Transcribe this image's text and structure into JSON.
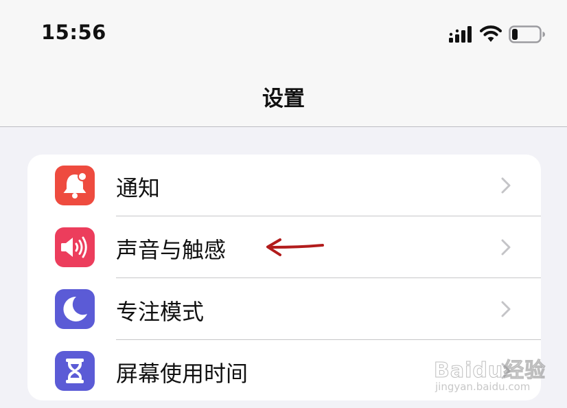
{
  "status_bar": {
    "time": "15:56",
    "icons": [
      "cellular-signal-icon",
      "wifi-icon",
      "battery-icon"
    ],
    "battery_level": 0.2
  },
  "nav": {
    "title": "设置"
  },
  "settings": {
    "items": [
      {
        "label": "通知",
        "icon": "bell-icon",
        "icon_color": "#ee4b3f"
      },
      {
        "label": "声音与触感",
        "icon": "speaker-icon",
        "icon_color": "#ec3d5c"
      },
      {
        "label": "专注模式",
        "icon": "moon-icon",
        "icon_color": "#5b5bd6"
      },
      {
        "label": "屏幕使用时间",
        "icon": "hourglass-icon",
        "icon_color": "#5b5bd6"
      }
    ]
  },
  "annotation": {
    "type": "arrow",
    "color": "#b21c1c",
    "points_to": "声音与触感"
  },
  "watermark": {
    "main": "Baidu经验",
    "sub": "jingyan.baidu.com"
  }
}
